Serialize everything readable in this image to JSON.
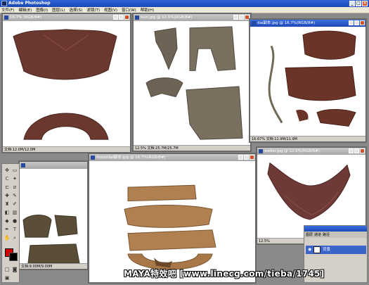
{
  "app": {
    "title": "Adobe Photoshop"
  },
  "menu": [
    "文件(F)",
    "编辑(E)",
    "图像(I)",
    "图层(L)",
    "选择(S)",
    "滤镜(T)",
    "视图(V)",
    "窗口(W)",
    "帮助(H)"
  ],
  "windows": {
    "w1": {
      "title": "16.7% (RGB/8#)",
      "status": "文档:12.0M/12.0M"
    },
    "w2": {
      "title": "kuzi.jpg @ 12.5%(RGB/8#)",
      "zoom": "12.5%",
      "status": "文档:25.7M/25.7M"
    },
    "w3": {
      "title": "dai副本.jpg @ 16.7%(RGB/8#)",
      "zoom": "16.67%",
      "status": "文档:11.9M/11.9M"
    },
    "w4": {
      "title": "",
      "status": "文档:9.00M/9.00M"
    },
    "w5": {
      "title": "maozidai副本.jpg @ 16.7%(RGB/8#)",
      "status": ""
    },
    "w6": {
      "title": "weibo.jpg @ 12.5%(RGB/8#)",
      "zoom": "12.5%",
      "status": ""
    }
  },
  "layers": {
    "tabs": [
      "图层",
      "通道",
      "路径"
    ],
    "layer_name": "背景"
  },
  "colors": {
    "foreground": "#d40000",
    "background": "#000000"
  },
  "watermark": "MAYA特效吧 [www.linecg.com/tieba/1745]"
}
